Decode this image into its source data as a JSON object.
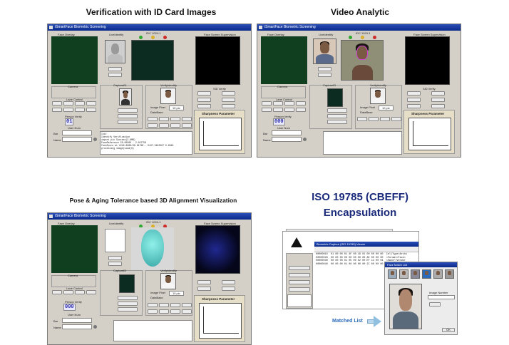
{
  "captions": {
    "verification": "Verification with ID Card Images",
    "video": "Video Analytic",
    "pose": "Pose & Aging Tolerance based 3D Alignment Visualization",
    "iso_line1": "ISO 19785 (CBEFF)",
    "iso_line2": "Encapsulation",
    "matched": "Matched List"
  },
  "app": {
    "title": "iSmartFace Biometric Screening",
    "face_overlay_label": "Face Overlay",
    "live_identify": "LiveIdentify",
    "capture_id": "CaptureID",
    "verify_identify": "VerifyIdentify",
    "grid_label": "IDC 1024-1",
    "face_screen_label": "Face Screen Supervision",
    "sharpness": "Sharpness Parameter",
    "person_verify": "Person Verify",
    "user_num": "User Num",
    "lane_control": "Lane Control",
    "camera": "Camera",
    "id_verify": "SID Verify",
    "radio_image_pixel": "Image Pixel",
    "radio_database": "DataBase",
    "select_value": "10 pic",
    "digits_a": "01",
    "digits_b": "000",
    "bar_label": "Bar",
    "name_label": "Name",
    "log_text": "Init\nIdentify Verification\nimport pic Success(3.8MB)\nFaceReference 50.00000 - 2.047758\nFaceScore at 1018.6988/06.81796.. 0137.5492367 9.6948\nprocessing image(Load(6)"
  },
  "dots": [
    "#2fa82f",
    "#d9b02a",
    "#cf2a2a"
  ],
  "iso": {
    "window_title": "Biometric Capture  (ISO 19785) Viewer",
    "hex_lines": [
      "00000010  01 00 00 01 4F 00 49 01 00 00 00 00  CellType>Archi",
      "00000020  00 00 00 00 00 00 00 00 AE 00 00 00  <Format>Face<",
      "00000030  00 00 00 01 05 00 02 00 EF 12 00 04  <Owner>Vendor",
      "00000040  00 00 00 01 00 00 00 00 2C 00 00 00  <Id>Face</Id>"
    ],
    "matched_window_title": "Face Match List",
    "image_number_label": "Image Number",
    "ok_label": "OK"
  }
}
